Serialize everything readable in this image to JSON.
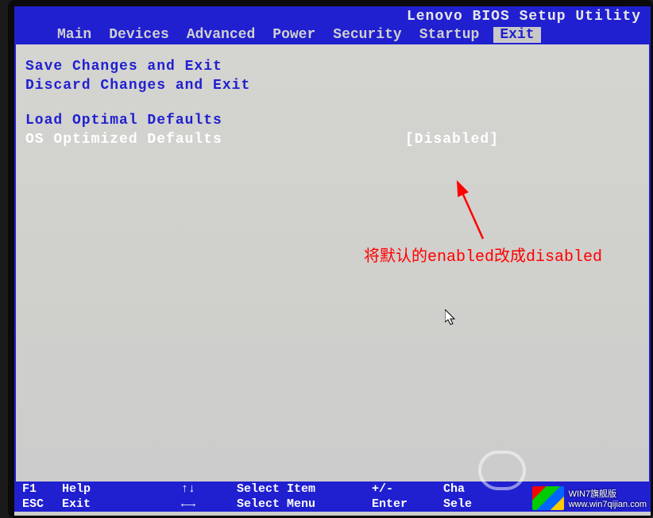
{
  "bios_title": "Lenovo BIOS Setup Utility",
  "tabs": {
    "main": "Main",
    "devices": "Devices",
    "advanced": "Advanced",
    "power": "Power",
    "security": "Security",
    "startup": "Startup",
    "exit": "Exit"
  },
  "options": {
    "save_exit": "Save Changes and Exit",
    "discard_exit": "Discard Changes and Exit",
    "load_optimal": "Load Optimal Defaults",
    "os_optimized": "OS Optimized Defaults",
    "os_optimized_value": "[Disabled]"
  },
  "annotation": "将默认的enabled改成disabled",
  "footer": {
    "f1_key": "F1",
    "f1_label": "Help",
    "esc_key": "ESC",
    "esc_label": "Exit",
    "arrows_key": "↑↓",
    "arrows_label": "Select Item",
    "lr_key": "←→",
    "lr_label": "Select Menu",
    "pm_key": "+/-",
    "pm_label": "Cha",
    "enter_key": "Enter",
    "enter_label": "Sele"
  },
  "watermark": {
    "title": "WIN7旗舰版",
    "url": "www.win7qijian.com"
  }
}
